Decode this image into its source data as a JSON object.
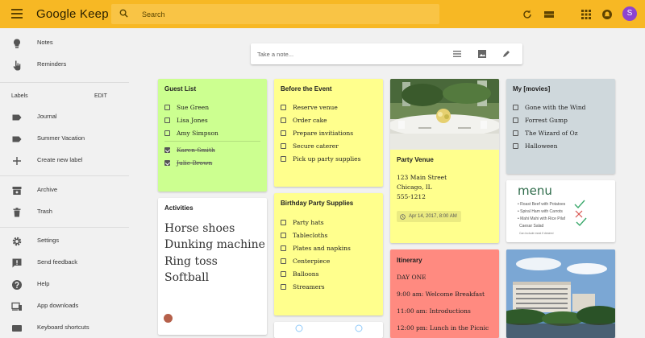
{
  "app": {
    "title": "Google Keep",
    "user_initial": "S"
  },
  "search": {
    "placeholder": "Search"
  },
  "sidebar": {
    "items": [
      {
        "label": "Notes"
      },
      {
        "label": "Reminders"
      }
    ],
    "labels_heading": "Labels",
    "edit_label": "EDIT",
    "labels": [
      {
        "label": "Journal"
      },
      {
        "label": "Summer Vacation"
      },
      {
        "label": "Create new label"
      }
    ],
    "archive": "Archive",
    "trash": "Trash",
    "bottom": [
      {
        "label": "Settings"
      },
      {
        "label": "Send feedback"
      },
      {
        "label": "Help"
      },
      {
        "label": "App downloads"
      },
      {
        "label": "Keyboard shortcuts"
      }
    ]
  },
  "take_note": {
    "placeholder": "Take a note..."
  },
  "notes": {
    "guest_list": {
      "title": "Guest List",
      "items": [
        {
          "text": "Sue Green",
          "checked": false
        },
        {
          "text": "Lisa Jones",
          "checked": false
        },
        {
          "text": "Amy Simpson",
          "checked": false
        },
        {
          "text": "Karen Smith",
          "checked": true
        },
        {
          "text": "Julie Brown",
          "checked": true
        }
      ]
    },
    "activities": {
      "title": "Activities",
      "lines": [
        "Horse shoes",
        "Dunking machine",
        "Ring toss",
        "Softball"
      ]
    },
    "before_event": {
      "title": "Before the Event",
      "items": [
        {
          "text": "Reserve venue"
        },
        {
          "text": "Order cake"
        },
        {
          "text": "Prepare invitiations"
        },
        {
          "text": "Secure caterer"
        },
        {
          "text": "Pick up party supplies"
        }
      ]
    },
    "birthday_supplies": {
      "title": "Birthday Party Supplies",
      "items": [
        {
          "text": "Party hats"
        },
        {
          "text": "Tablecloths"
        },
        {
          "text": "Plates and napkins"
        },
        {
          "text": "Centerpiece"
        },
        {
          "text": "Balloons"
        },
        {
          "text": "Streamers"
        }
      ]
    },
    "party_venue": {
      "title": "Party Venue",
      "lines": [
        "123 Main Street",
        "Chicago, IL",
        "555-1212"
      ],
      "reminder": "Apr 14, 2017, 8:00 AM"
    },
    "itinerary": {
      "title": "Itinerary",
      "lines": [
        "DAY ONE",
        "9:00 am: Welcome Breakfast",
        "11:00 am: Introductions",
        "12:00 pm: Lunch in the Picnic"
      ]
    },
    "movies": {
      "title": "My [movies]",
      "items": [
        {
          "text": "Gone with the Wind"
        },
        {
          "text": "Forrest Gump"
        },
        {
          "text": "The Wizard of Oz"
        },
        {
          "text": "Halloween"
        }
      ]
    },
    "menu": {
      "heading": "menu",
      "lines": [
        "Roast Beef with Potatoes",
        "Spiral Ham with Carrots",
        "Mahi Mahi with Rice Pilaf",
        "Caesar Salad",
        "Can include meat if desired"
      ]
    }
  },
  "colors": {
    "topbar": "#f7b824",
    "green": "#ccff90",
    "yellow": "#ffff8d",
    "red": "#ff8a80",
    "gray": "#cfd8dc"
  }
}
